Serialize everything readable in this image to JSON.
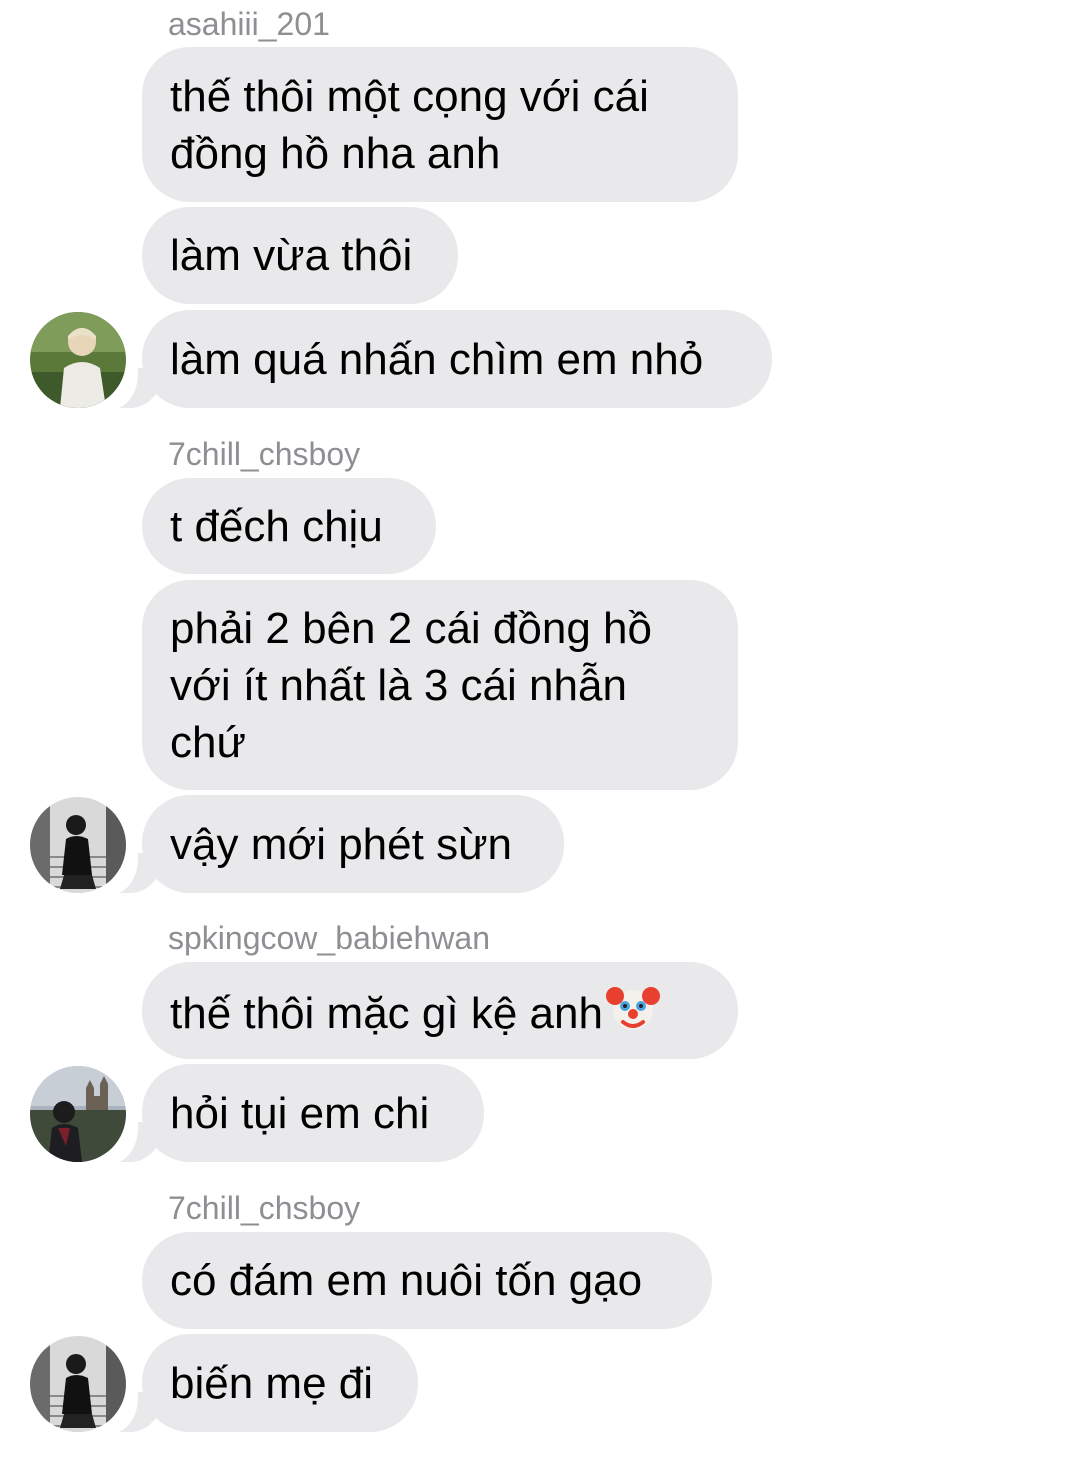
{
  "messages": [
    {
      "sender": "asahiii_201",
      "bubbles": [
        "thế thôi một cọng với cái\nđồng hồ nha anh",
        "làm vừa thôi",
        "làm quá nhấn chìm em nhỏ"
      ]
    },
    {
      "sender": "7chill_chsboy",
      "bubbles": [
        "t đếch chịu",
        "phải 2 bên 2 cái đồng hồ\nvới ít nhất là 3 cái nhẫn\nchứ",
        "vậy mới phét sừn"
      ]
    },
    {
      "sender": "spkingcow_babiehwan",
      "bubbles": [
        "thế thôi mặc gì kệ anh",
        "hỏi tụi em chi"
      ]
    },
    {
      "sender": "7chill_chsboy",
      "bubbles": [
        "có đám em nuôi tốn gạo",
        "biến mẹ đi"
      ]
    }
  ],
  "icons": {
    "avatar_1": "avatar-person-outdoors",
    "avatar_2": "avatar-person-black-white-stairs",
    "avatar_3": "avatar-person-castle-background",
    "emoji": "clown-face-icon"
  },
  "colors": {
    "bubble": "#e9e9eb",
    "sender_text": "#8e8e93",
    "message_text": "#000000",
    "background": "#ffffff"
  }
}
